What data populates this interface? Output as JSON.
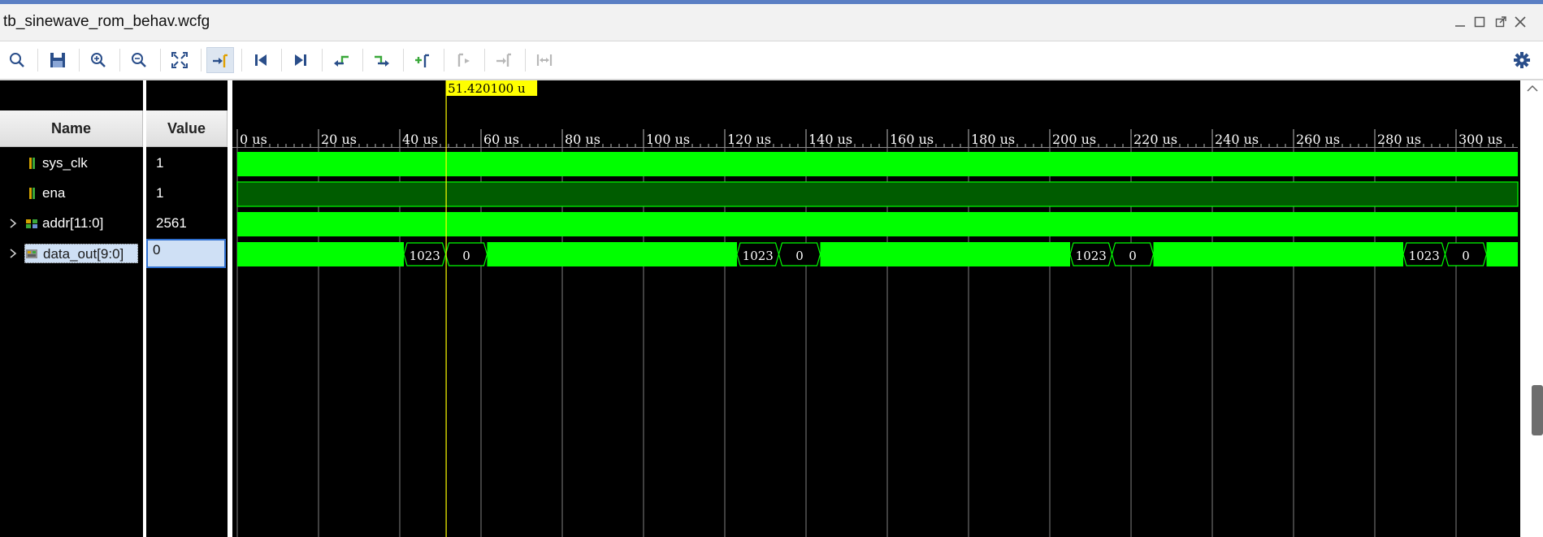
{
  "window": {
    "title": "tb_sinewave_rom_behav.wcfg"
  },
  "toolbar": {
    "buttons": [
      {
        "name": "search-button",
        "icon": "search-icon"
      },
      {
        "name": "save-button",
        "icon": "save-icon"
      },
      {
        "name": "zoom-in-button",
        "icon": "zoom-in-icon"
      },
      {
        "name": "zoom-out-button",
        "icon": "zoom-out-icon"
      },
      {
        "name": "zoom-fit-button",
        "icon": "zoom-fit-icon"
      },
      {
        "name": "go-to-cursor-button",
        "icon": "go-to-cursor-icon",
        "active": true
      },
      {
        "name": "go-to-time-0-button",
        "icon": "go-to-start-icon"
      },
      {
        "name": "go-to-last-time-button",
        "icon": "go-to-end-icon"
      },
      {
        "name": "previous-transition-button",
        "icon": "previous-transition-icon"
      },
      {
        "name": "next-transition-button",
        "icon": "next-transition-icon"
      },
      {
        "name": "add-marker-button",
        "icon": "add-marker-icon"
      },
      {
        "name": "previous-marker-button",
        "icon": "previous-marker-icon",
        "disabled": true
      },
      {
        "name": "next-marker-button",
        "icon": "next-marker-icon",
        "disabled": true
      },
      {
        "name": "swap-cursors-button",
        "icon": "swap-cursors-icon",
        "disabled": true
      }
    ],
    "settings_icon": "gear-icon"
  },
  "columns": {
    "name": "Name",
    "value": "Value"
  },
  "signals": [
    {
      "name": "sys_clk",
      "value": "1",
      "icon": "bit-signal-icon",
      "expandable": false
    },
    {
      "name": "ena",
      "value": "1",
      "icon": "bit-signal-icon",
      "expandable": false
    },
    {
      "name": "addr[11:0]",
      "value": "2561",
      "icon": "bus-signal-icon",
      "expandable": true
    },
    {
      "name": "data_out[9:0]",
      "value": "0",
      "icon": "analog-bus-signal-icon",
      "expandable": true,
      "selected": true
    }
  ],
  "cursor": {
    "label": "51.420100 u",
    "time_us": 51.4201
  },
  "timeline": {
    "unit": "us",
    "start_us": 0,
    "major_step_us": 20,
    "labels": [
      "0 us",
      "20 us",
      "40 us",
      "60 us",
      "80 us",
      "100 us",
      "120 us",
      "140 us",
      "160 us",
      "180 us",
      "200 us",
      "220 us",
      "240 us",
      "260 us",
      "280 us",
      "300 us"
    ]
  },
  "data_out_segments": [
    {
      "start_us": 41.0,
      "end_us": 51.3,
      "label": "1023"
    },
    {
      "start_us": 51.3,
      "end_us": 61.5,
      "label": "0"
    },
    {
      "start_us": 123.0,
      "end_us": 133.3,
      "label": "1023"
    },
    {
      "start_us": 133.3,
      "end_us": 143.5,
      "label": "0"
    },
    {
      "start_us": 205.0,
      "end_us": 215.3,
      "label": "1023"
    },
    {
      "start_us": 215.3,
      "end_us": 225.5,
      "label": "0"
    },
    {
      "start_us": 287.0,
      "end_us": 297.3,
      "label": "1023"
    },
    {
      "start_us": 297.3,
      "end_us": 307.5,
      "label": "0"
    }
  ],
  "colors": {
    "wave": "#00ff00",
    "wave_dark": "#005c00",
    "cursor": "#ffff00",
    "grid": "#a0a0a0",
    "background": "#000000"
  }
}
